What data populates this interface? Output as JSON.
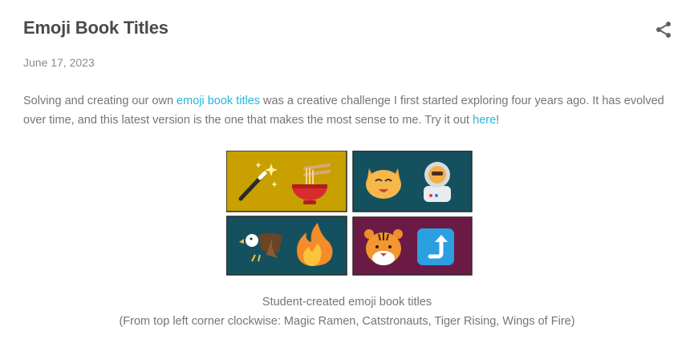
{
  "post": {
    "title": "Emoji Book Titles",
    "date": "June 17, 2023",
    "body_intro": "Solving and creating our own ",
    "link1_text": "emoji book titles",
    "body_middle": " was a creative challenge I first started exploring four years ago. It has evolved over time, and this latest version is the one that makes the most sense to me. Try it out ",
    "link2_text": "here",
    "body_end": "!"
  },
  "share": {
    "icon": "share-icon"
  },
  "figure": {
    "tiles": [
      {
        "book": "Magic Ramen",
        "emoji": [
          "magic-wand-icon",
          "ramen-bowl-icon"
        ],
        "color": "#c8a000"
      },
      {
        "book": "Catstronauts",
        "emoji": [
          "cat-face-icon",
          "astronaut-icon"
        ],
        "color": "#15505e"
      },
      {
        "book": "Wings of Fire",
        "emoji": [
          "eagle-icon",
          "fire-icon"
        ],
        "color": "#15505e"
      },
      {
        "book": "Tiger Rising",
        "emoji": [
          "tiger-face-icon",
          "up-arrow-icon"
        ],
        "color": "#6b1a45"
      }
    ],
    "caption_line1": "Student-created emoji book titles",
    "caption_line2": "(From top left corner clockwise: Magic Ramen, Catstronauts, Tiger Rising, Wings of Fire)"
  },
  "colors": {
    "link": "#26b6d9",
    "title": "#4a4a4a",
    "text": "#757575"
  }
}
